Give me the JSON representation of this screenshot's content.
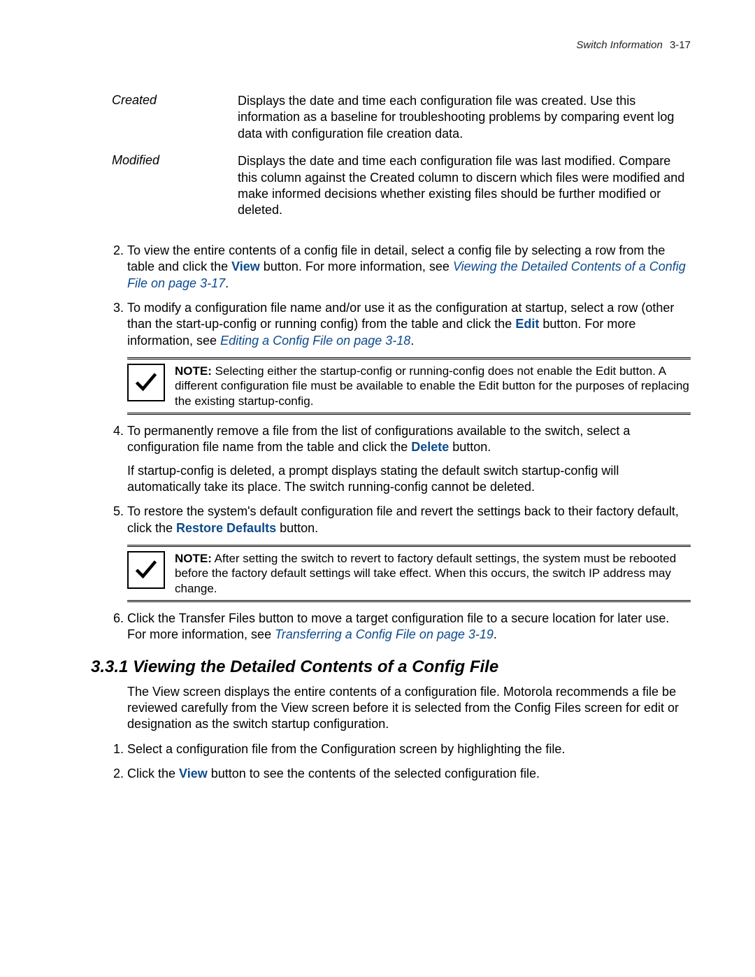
{
  "header": {
    "title": "Switch Information",
    "page": "3-17"
  },
  "definitions": [
    {
      "term": "Created",
      "body": "Displays the date and time each configuration file was created. Use this information as a baseline for troubleshooting problems by comparing event log data with configuration file creation data."
    },
    {
      "term": "Modified",
      "body": "Displays the date and time each configuration file was last modified. Compare this column against the Created column to discern which files were modified and make informed decisions whether existing files should be further modified or deleted."
    }
  ],
  "list_a": {
    "item2": {
      "num": "2.",
      "pre": "To view the entire contents of a config file in detail, select a config file by selecting a row from the table and click the ",
      "view_label": "View",
      "mid": " button. For more information, see ",
      "link": "Viewing the Detailed Contents of a Config File on page 3-17",
      "post": "."
    },
    "item3": {
      "num": "3.",
      "pre": "To modify a configuration file name and/or use it as the configuration at startup, select a row (other than the start-up-config or running config) from the table and click the ",
      "edit_label": "Edit",
      "mid": " button. For more information, see ",
      "link": "Editing a Config File on page 3-18",
      "post": "."
    }
  },
  "note1": {
    "label": "NOTE:",
    "body": " Selecting either the startup-config or running-config does not enable the Edit button. A different configuration file must be available to enable the Edit button for the purposes of replacing the existing startup-config."
  },
  "list_b": {
    "item4": {
      "num": "4.",
      "pre": "To permanently remove a file from the list of configurations available to the switch, select a configuration file name from the table and click the ",
      "delete_label": "Delete",
      "post": " button.",
      "para2": "If startup-config is deleted, a prompt displays stating the default switch startup-config will automatically take its place. The switch running-config cannot be deleted."
    },
    "item5": {
      "num": "5.",
      "pre": "To restore the system's default configuration file and revert the settings back to their factory default, click the ",
      "restore_label": "Restore Defaults",
      "post": " button."
    }
  },
  "note2": {
    "label": "NOTE:",
    "body": "  After setting the switch to revert to factory default settings, the system must be rebooted before the factory default settings will take effect. When this occurs, the switch IP address may change."
  },
  "list_c": {
    "item6": {
      "num": "6.",
      "pre": "Click the Transfer Files button to move a target configuration file to a secure location for later use. For more information, see ",
      "link": "Transferring a Config File on page 3-19",
      "post": "."
    }
  },
  "section": {
    "heading": "3.3.1 Viewing the Detailed Contents of a Config File",
    "intro": "The View screen displays the entire contents of a configuration file. Motorola recommends a file be reviewed carefully from the View screen before it is selected from the Config Files screen for edit or designation as the switch startup configuration.",
    "step1": {
      "num": "1.",
      "text": "Select a configuration file from the Configuration screen by highlighting the file."
    },
    "step2": {
      "num": "2.",
      "pre": "Click the ",
      "view_label": "View",
      "post": " button to see the contents of the selected configuration file."
    }
  }
}
